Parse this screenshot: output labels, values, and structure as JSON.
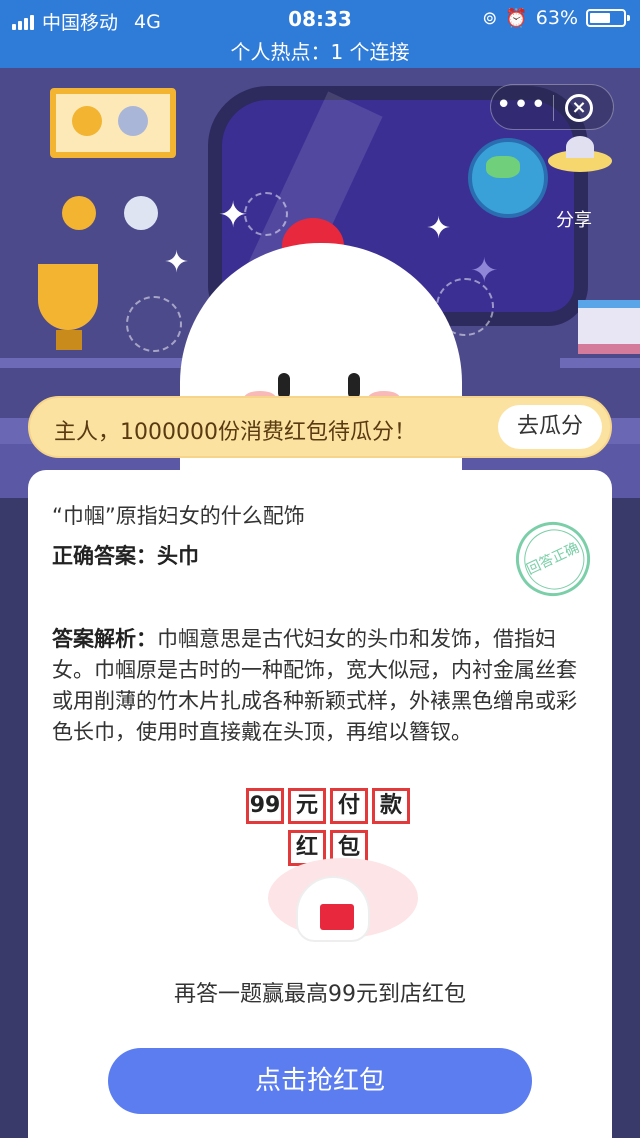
{
  "status_bar": {
    "carrier": "中国移动",
    "network": "4G",
    "time": "08:33",
    "battery": "63%",
    "battery_level": 0.63,
    "hotspot": "个人热点：1 个连接"
  },
  "header": {
    "share_label": "分享"
  },
  "banner": {
    "text": "主人，1000000份消费红包待瓜分！",
    "button": "去瓜分"
  },
  "card": {
    "question": "“巾帼”原指妇女的什么配饰",
    "answer_label": "正确答案：",
    "answer_value": "头巾",
    "stamp": "回答正确",
    "analysis_label": "答案解析：",
    "analysis_text": "巾帼意思是古代妇女的头巾和发饰，借指妇女。巾帼原是古时的一种配饰，宽大似冠，内衬金属丝套或用削薄的竹木片扎成各种新颖式样，外裱黑色缯帛或彩色长巾，使用时直接戴在头顶，再绾以簪钗。",
    "promo_line1": [
      "99",
      "元",
      "付",
      "款"
    ],
    "promo_line2": [
      "红",
      "包"
    ],
    "promo_caption": "再答一题赢最高99元到店红包",
    "cta": "点击抢红包"
  },
  "colors": {
    "status_bar": "#2f7bd8",
    "cta": "#5b7df0",
    "banner": "#fbe2a0",
    "promo_border": "#e23a3a",
    "stamp": "#7bcfa8"
  }
}
